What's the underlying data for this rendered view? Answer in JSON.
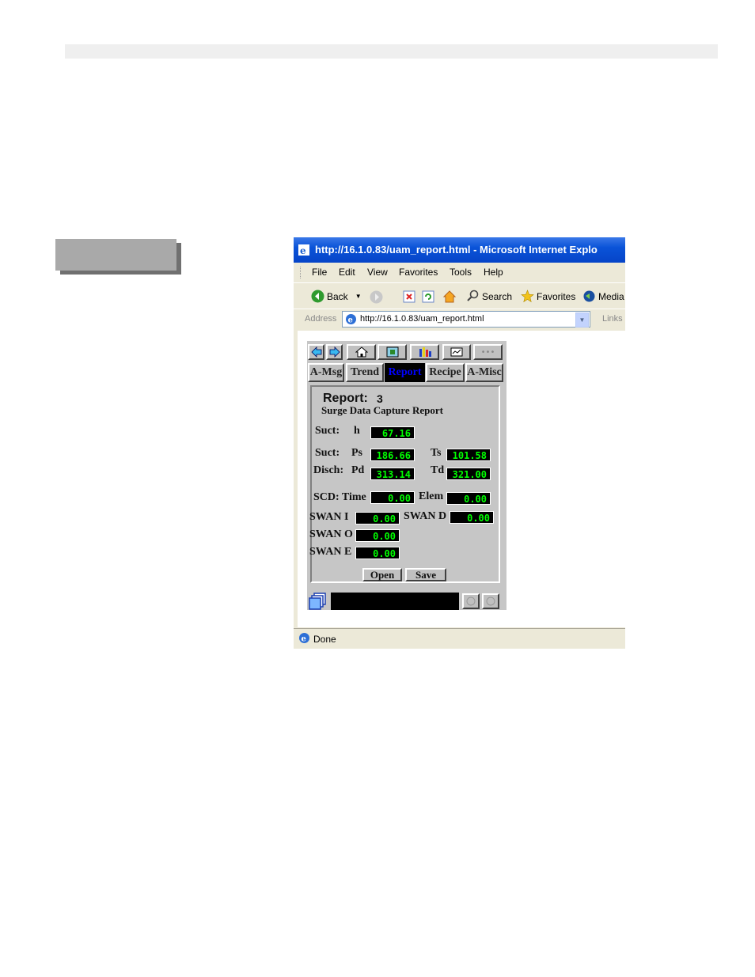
{
  "browser": {
    "title": "http://16.1.0.83/uam_report.html - Microsoft Internet Explo",
    "menu": [
      "File",
      "Edit",
      "View",
      "Favorites",
      "Tools",
      "Help"
    ],
    "toolbar": {
      "back_label": "Back",
      "search_label": "Search",
      "favorites_label": "Favorites",
      "media_label": "Media"
    },
    "address": {
      "label": "Address",
      "value": "http://16.1.0.83/uam_report.html",
      "links_label": "Links"
    },
    "status": "Done"
  },
  "applet": {
    "tabs": [
      "A-Msg",
      "Trend",
      "Report",
      "Recipe",
      "A-Misc"
    ],
    "active_tab": "Report",
    "report": {
      "title_label": "Report:",
      "number": "3",
      "subtitle": "Surge Data Capture Report"
    },
    "fields": {
      "suct_h_label": "Suct:",
      "suct_h_sym": "h",
      "suct_h_value": "67.16",
      "suct_ps_label": "Suct:",
      "suct_ps_sym": "Ps",
      "suct_ps_value": "186.66",
      "ts_label": "Ts",
      "ts_value": "101.58",
      "disch_label": "Disch:",
      "disch_sym": "Pd",
      "disch_value": "313.14",
      "td_label": "Td",
      "td_value": "321.00",
      "scd_label": "SCD: Time",
      "scd_value": "0.00",
      "elem_label": "Elem",
      "elem_value": "0.00",
      "swan_i_label": "SWAN I",
      "swan_i_value": "0.00",
      "swan_d_label": "SWAN D",
      "swan_d_value": "0.00",
      "swan_o_label": "SWAN O",
      "swan_o_value": "0.00",
      "swan_e_label": "SWAN E",
      "swan_e_value": "0.00"
    },
    "open_label": "Open",
    "save_label": "Save"
  },
  "colors": {
    "lcd_bg": "#000000",
    "lcd_text": "#00ff00",
    "active_tab_text": "#0000ff",
    "title_bar": "#0a53d8"
  }
}
